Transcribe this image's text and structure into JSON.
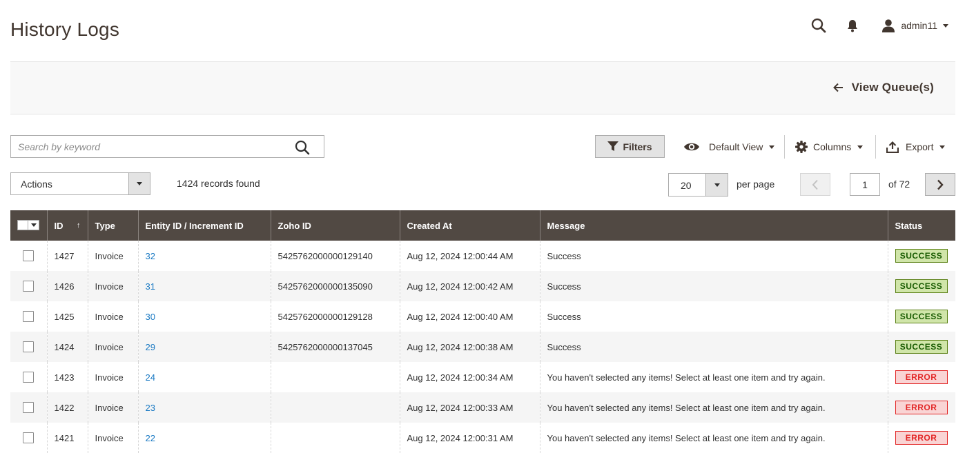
{
  "header": {
    "title": "History Logs",
    "user": "admin11",
    "icons": {
      "search": "search-icon",
      "bell": "bell-icon",
      "user": "user-icon"
    }
  },
  "page_actions": {
    "back_label": "View Queue(s)"
  },
  "toolbar": {
    "search_placeholder": "Search by keyword",
    "filters_label": "Filters",
    "view_label": "Default View",
    "columns_label": "Columns",
    "export_label": "Export",
    "actions_label": "Actions",
    "records_found": "1424 records found",
    "per_page_value": "20",
    "per_page_label": "per page",
    "current_page": "1",
    "total_pages": "of 72"
  },
  "grid": {
    "columns": {
      "id": "ID",
      "sort_indicator": "↑",
      "type": "Type",
      "entity": "Entity ID / Increment ID",
      "zoho": "Zoho ID",
      "created": "Created At",
      "message": "Message",
      "status": "Status"
    },
    "rows": [
      {
        "id": "1427",
        "type": "Invoice",
        "entity": "32",
        "zoho": "5425762000000129140",
        "created": "Aug 12, 2024 12:00:44 AM",
        "message": "Success",
        "status": "SUCCESS"
      },
      {
        "id": "1426",
        "type": "Invoice",
        "entity": "31",
        "zoho": "5425762000000135090",
        "created": "Aug 12, 2024 12:00:42 AM",
        "message": "Success",
        "status": "SUCCESS"
      },
      {
        "id": "1425",
        "type": "Invoice",
        "entity": "30",
        "zoho": "5425762000000129128",
        "created": "Aug 12, 2024 12:00:40 AM",
        "message": "Success",
        "status": "SUCCESS"
      },
      {
        "id": "1424",
        "type": "Invoice",
        "entity": "29",
        "zoho": "5425762000000137045",
        "created": "Aug 12, 2024 12:00:38 AM",
        "message": "Success",
        "status": "SUCCESS"
      },
      {
        "id": "1423",
        "type": "Invoice",
        "entity": "24",
        "zoho": "",
        "created": "Aug 12, 2024 12:00:34 AM",
        "message": "You haven't selected any items! Select at least one item and try again.",
        "status": "ERROR"
      },
      {
        "id": "1422",
        "type": "Invoice",
        "entity": "23",
        "zoho": "",
        "created": "Aug 12, 2024 12:00:33 AM",
        "message": "You haven't selected any items! Select at least one item and try again.",
        "status": "ERROR"
      },
      {
        "id": "1421",
        "type": "Invoice",
        "entity": "22",
        "zoho": "",
        "created": "Aug 12, 2024 12:00:31 AM",
        "message": "You haven't selected any items! Select at least one item and try again.",
        "status": "ERROR"
      }
    ]
  },
  "colors": {
    "header_bg": "#514943",
    "link": "#1979c3",
    "success_bg": "#d0e5a9",
    "success_text": "#185b00",
    "error_bg": "#f9d4d4",
    "error_text": "#e22626"
  }
}
